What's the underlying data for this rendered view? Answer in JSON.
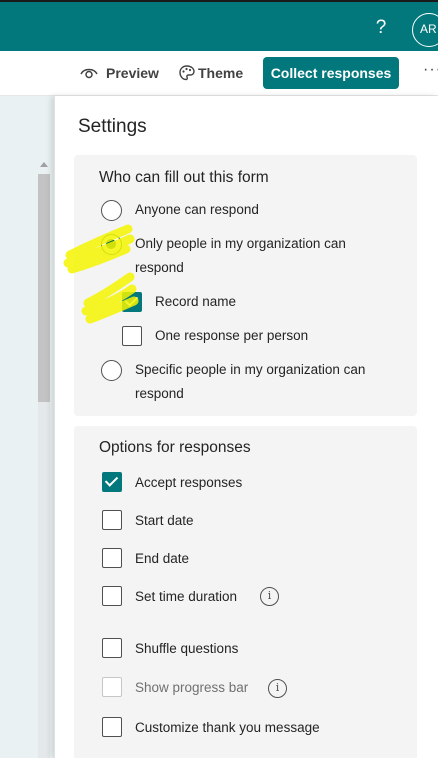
{
  "header": {
    "help_glyph": "?",
    "avatar_initials": "AR",
    "brand_color": "#03787c"
  },
  "toolbar": {
    "preview_label": "Preview",
    "theme_label": "Theme",
    "collect_label": "Collect responses",
    "more_glyph": "···"
  },
  "settings": {
    "title": "Settings",
    "who": {
      "title": "Who can fill out this form",
      "anyone_label": "Anyone can respond",
      "org_label": "Only people in my organization can respond",
      "record_name_label": "Record name",
      "one_response_label": "One response per person",
      "specific_label": "Specific people in my organization can respond",
      "selected": "Only people in my organization can respond",
      "record_name_checked": true,
      "one_response_checked": false
    },
    "options": {
      "title": "Options for responses",
      "accept_label": "Accept responses",
      "start_label": "Start date",
      "end_label": "End date",
      "duration_label": "Set time duration",
      "shuffle_label": "Shuffle questions",
      "progress_label": "Show progress bar",
      "thankyou_label": "Customize thank you message",
      "accept_checked": true,
      "info_glyph": "i"
    }
  },
  "annotations": {
    "highlight_color": "#f5f500"
  }
}
